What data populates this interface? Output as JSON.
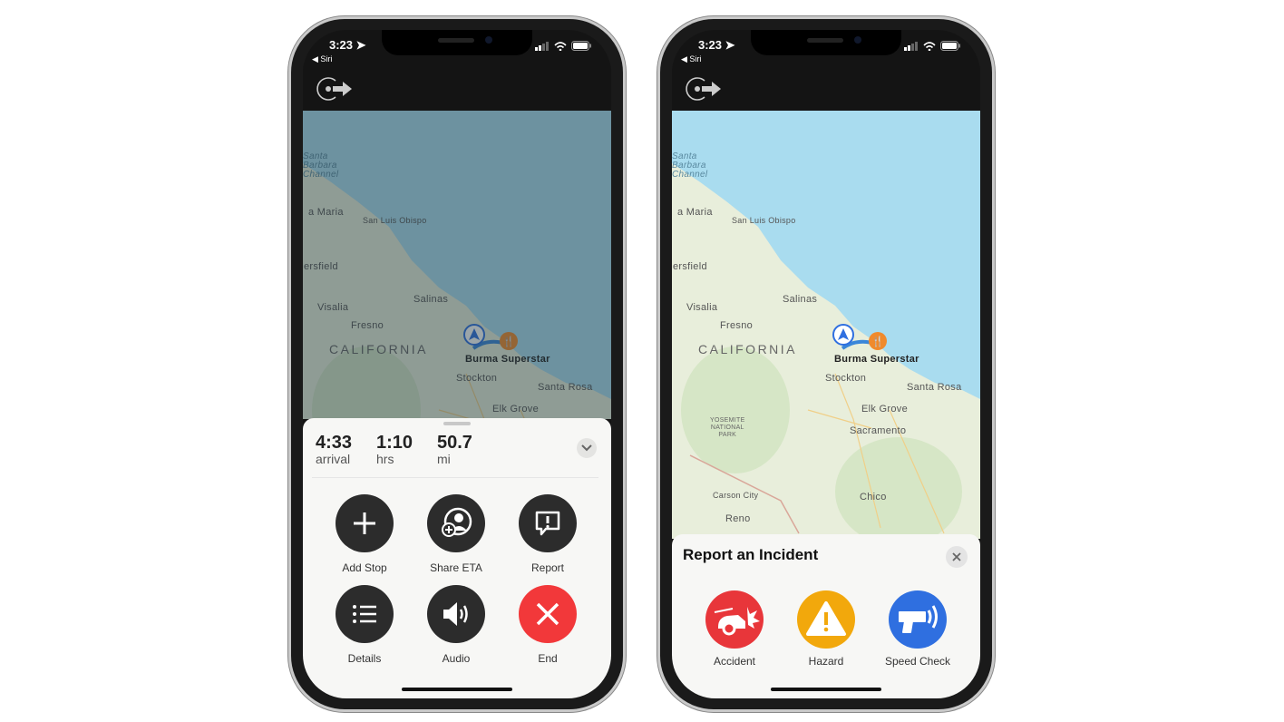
{
  "status": {
    "time": "3:23",
    "back_label": "◀ Siri"
  },
  "map": {
    "labels": [
      "Santa\nBarbara\nChannel",
      "a Maria",
      "San Luis Obispo",
      "ersfield",
      "Salinas",
      "Visalia",
      "Fresno",
      "CALIFORNIA",
      "Burma Superstar",
      "Stockton",
      "Santa Rosa",
      "Elk Grove",
      "YOSEMITE\nNATIONAL\nPARK",
      "Sacramento",
      "Carson City",
      "Chico",
      "Reno"
    ]
  },
  "left_phone": {
    "eta": [
      {
        "value": "4:33",
        "unit": "arrival"
      },
      {
        "value": "1:10",
        "unit": "hrs"
      },
      {
        "value": "50.7",
        "unit": "mi"
      }
    ],
    "actions": [
      {
        "label": "Add Stop",
        "icon": "plus-icon"
      },
      {
        "label": "Share ETA",
        "icon": "share-eta-icon"
      },
      {
        "label": "Report",
        "icon": "report-icon"
      },
      {
        "label": "Details",
        "icon": "list-icon"
      },
      {
        "label": "Audio",
        "icon": "speaker-icon"
      },
      {
        "label": "End",
        "icon": "x-icon"
      }
    ]
  },
  "right_phone": {
    "title": "Report an Incident",
    "incidents": [
      {
        "label": "Accident",
        "color": "#e8363a"
      },
      {
        "label": "Hazard",
        "color": "#f2a80c"
      },
      {
        "label": "Speed Check",
        "color": "#2f6fe0"
      }
    ]
  },
  "colors": {
    "ocean": "#a9dcef",
    "land": "#e8eedb",
    "end": "#f2383a",
    "button": "#2c2c2c"
  }
}
